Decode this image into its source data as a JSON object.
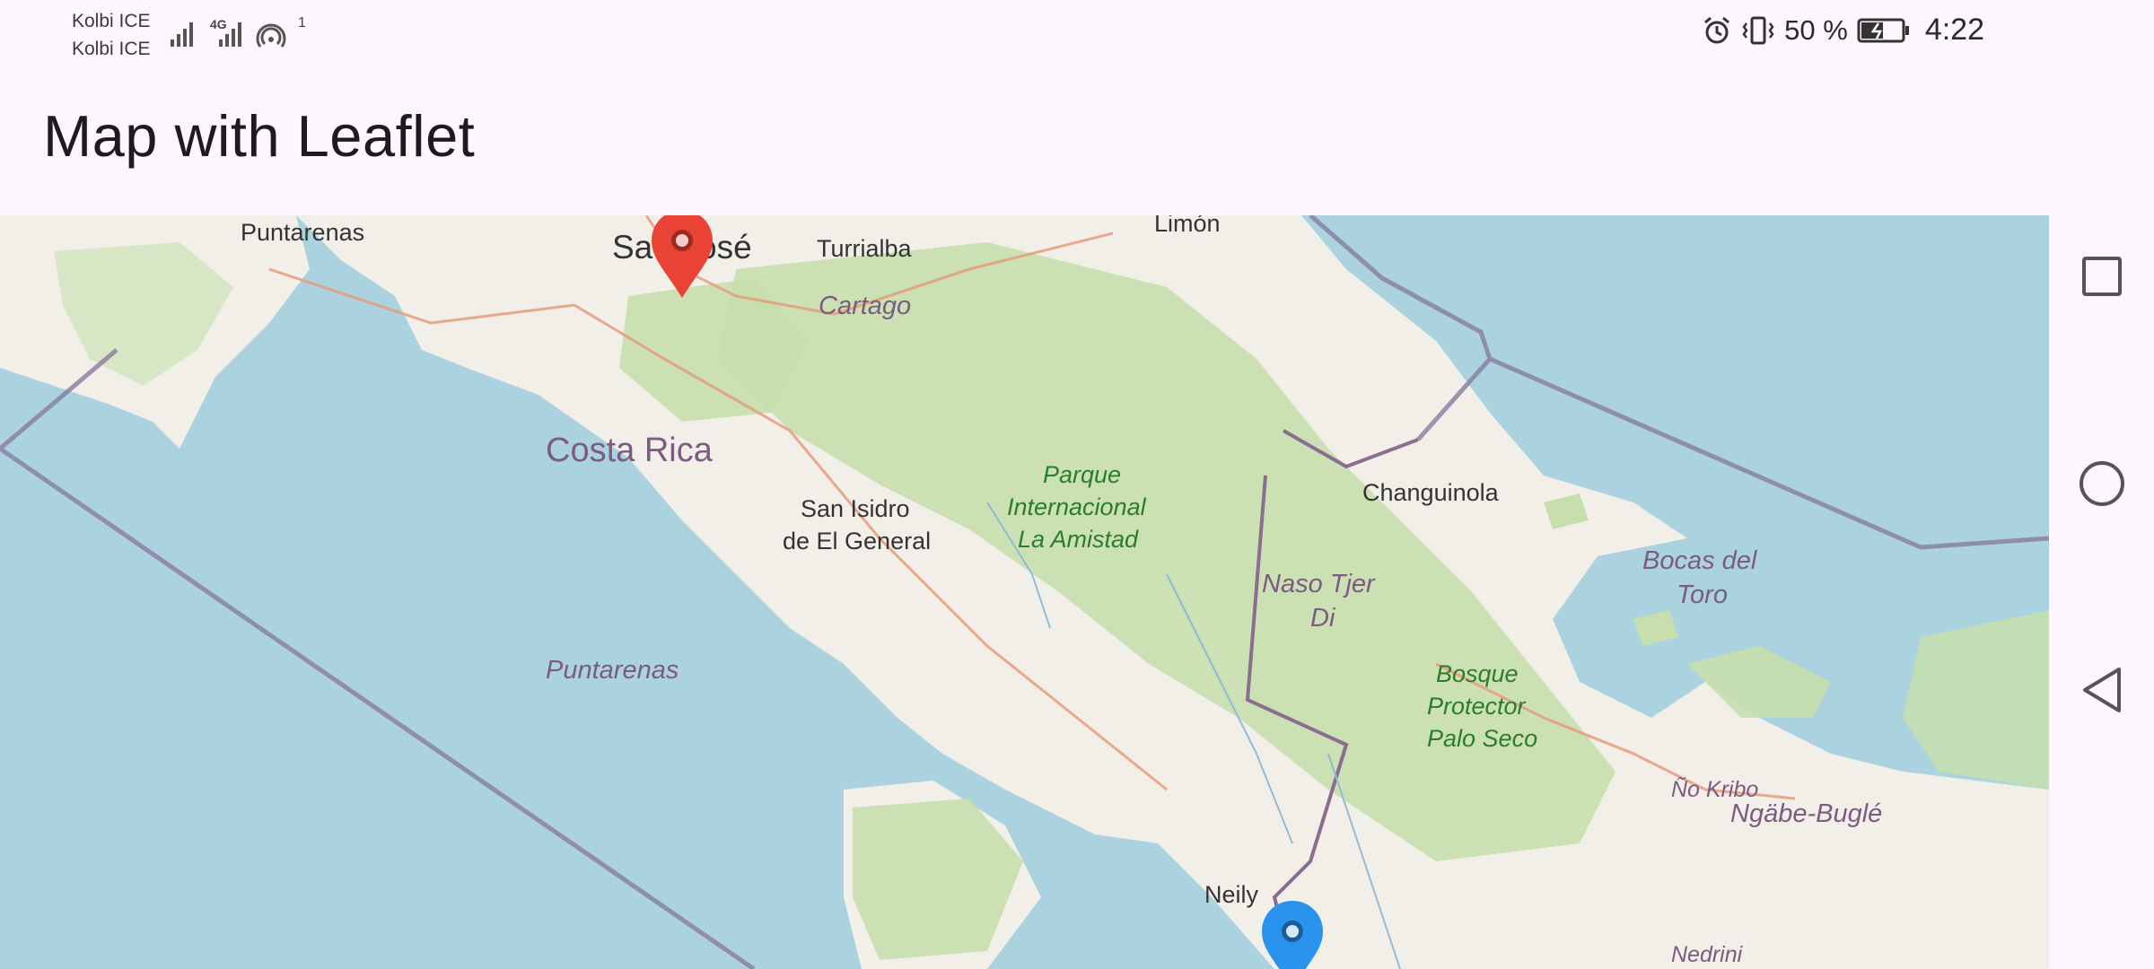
{
  "status_bar": {
    "carrier_1": "Kolbi ICE",
    "carrier_2": "Kolbi ICE",
    "network_type": "4G",
    "hotspot_count": "1",
    "battery_percent": "50 %",
    "time": "4:22",
    "icons": [
      "signal-icon",
      "alarm-icon",
      "vibrate-icon",
      "battery-icon",
      "hotspot-icon"
    ]
  },
  "app_bar": {
    "title": "Map with Leaflet"
  },
  "map": {
    "cities": [
      "Puntarenas",
      "San José",
      "Turrialba",
      "Limón",
      "Changuinola",
      "Neily"
    ],
    "city_san_jose_part1": "Sa",
    "city_san_jose_part2": "osé",
    "san_isidro_line1": "San Isidro",
    "san_isidro_line2": "de El General",
    "country": "Costa Rica",
    "region_cartago": "Cartago",
    "region_puntarenas": "Puntarenas",
    "bocas_line1": "Bocas del",
    "bocas_line2": "Toro",
    "naso_line1": "Naso Tjer",
    "naso_line2": "Di",
    "ngobe": "Ngäbe-Buglé",
    "no_kribo": "Ño Kribo",
    "nedrini": "Nedrini",
    "amistad_line1": "Parque",
    "amistad_line2": "Internacional",
    "amistad_line3": "La Amistad",
    "bosque_line1": "Bosque",
    "bosque_line2": "Protector",
    "bosque_line3": "Palo Seco",
    "markers": [
      {
        "name": "red-marker",
        "color": "#e94335"
      },
      {
        "name": "blue-marker",
        "color": "#2a93ee"
      }
    ]
  },
  "nav_bar": {
    "buttons": [
      "recents-button",
      "home-button",
      "back-button"
    ]
  },
  "colors": {
    "water": "#aad3df",
    "land": "#f2efe9",
    "forest": "#c8e0b0",
    "background": "#fdf7fd"
  }
}
